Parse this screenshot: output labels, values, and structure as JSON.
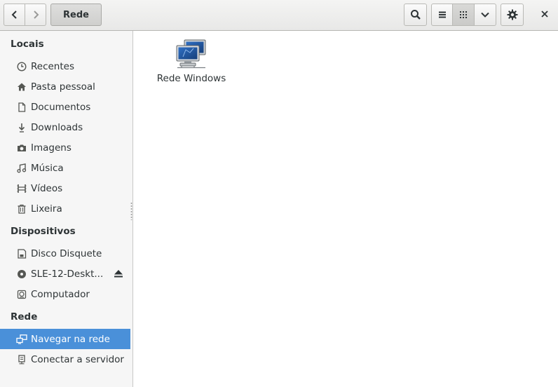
{
  "header": {
    "back_icon": "go-previous-icon",
    "forward_icon": "go-next-icon",
    "path_label": "Rede",
    "search_icon": "search-icon",
    "list_view_icon": "list-view-icon",
    "grid_view_icon": "grid-view-icon",
    "view_menu_icon": "chevron-down-icon",
    "settings_icon": "gear-icon",
    "close_icon": "close-icon"
  },
  "sidebar": {
    "sections": [
      {
        "title": "Locais"
      },
      {
        "title": "Dispositivos"
      },
      {
        "title": "Rede"
      }
    ],
    "places": [
      {
        "label": "Recentes",
        "icon": "clock-icon"
      },
      {
        "label": "Pasta pessoal",
        "icon": "home-icon"
      },
      {
        "label": "Documentos",
        "icon": "document-icon"
      },
      {
        "label": "Downloads",
        "icon": "download-icon"
      },
      {
        "label": "Imagens",
        "icon": "camera-icon"
      },
      {
        "label": "Música",
        "icon": "music-icon"
      },
      {
        "label": "Vídeos",
        "icon": "film-icon"
      },
      {
        "label": "Lixeira",
        "icon": "trash-icon"
      }
    ],
    "devices": [
      {
        "label": "Disco Disquete",
        "icon": "floppy-icon"
      },
      {
        "label": "SLE-12-Deskt...",
        "icon": "optical-disc-icon",
        "eject_icon": "eject-icon"
      },
      {
        "label": "Computador",
        "icon": "drive-icon"
      }
    ],
    "network": [
      {
        "label": "Navegar na rede",
        "icon": "network-icon",
        "selected": true
      },
      {
        "label": "Conectar a servidor",
        "icon": "server-icon"
      }
    ]
  },
  "content": {
    "items": [
      {
        "label": "Rede Windows",
        "icon": "network-workgroup-icon"
      }
    ]
  },
  "colors": {
    "selection": "#4a90d9",
    "sidebar_bg": "#f6f6f6",
    "header_bg": "#e8e8e7"
  }
}
